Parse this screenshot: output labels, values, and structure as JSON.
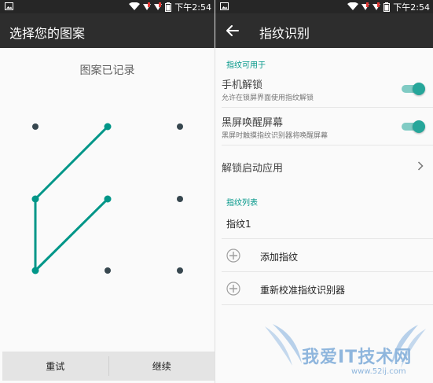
{
  "status": {
    "time": "下午2:54"
  },
  "left": {
    "title": "选择您的图案",
    "pattern_status": "图案已记录",
    "retry_label": "重试",
    "continue_label": "继续"
  },
  "right": {
    "title": "指纹识别",
    "section_available": "指纹可用于",
    "unlock_title": "手机解锁",
    "unlock_sub": "允许在锁屏界面使用指纹解锁",
    "wake_title": "黑屏唤醒屏幕",
    "wake_sub": "黑屏时触摸指纹识别器将唤醒屏幕",
    "launch_title": "解锁启动应用",
    "section_list": "指纹列表",
    "fingerprint_1": "指纹1",
    "add_label": "添加指纹",
    "calibrate_label": "重新校准指纹识别器"
  },
  "watermark": {
    "title": "我爱IT技术网",
    "url": "www.52ij.com"
  },
  "colors": {
    "accent": "#009688",
    "toolbar": "#2d2d2d",
    "statusbar": "#262626"
  }
}
